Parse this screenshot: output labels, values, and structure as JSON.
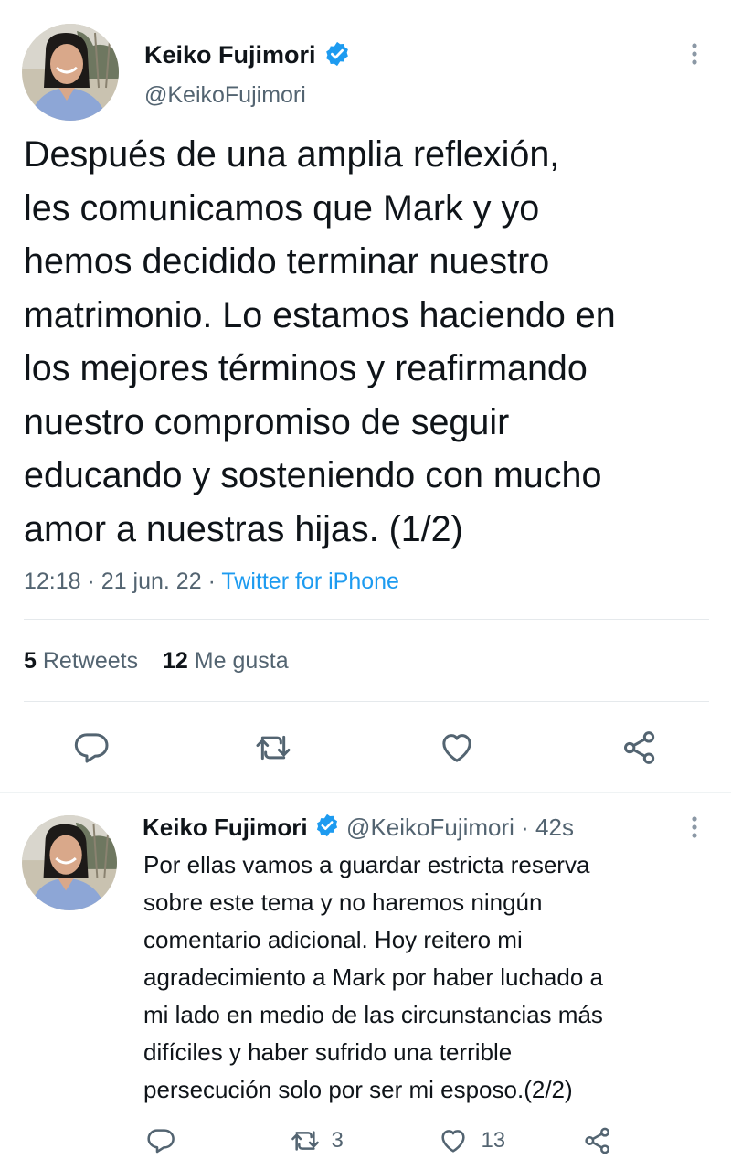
{
  "main_tweet": {
    "author_name": "Keiko Fujimori",
    "author_handle": "@KeikoFujimori",
    "text_lines": [
      "Después de una amplia reflexión,",
      "les comunicamos que Mark y yo",
      "hemos decidido terminar nuestro",
      "matrimonio. Lo estamos haciendo en",
      "los mejores términos y reafirmando",
      "nuestro compromiso de seguir",
      "educando y sosteniendo con mucho",
      "amor a nuestras hijas. (1/2)"
    ],
    "time": "12:18",
    "date": "21 jun. 22",
    "source": "Twitter for iPhone",
    "separator": "·",
    "retweets_count": "5",
    "retweets_label": "Retweets",
    "likes_count": "12",
    "likes_label": "Me gusta",
    "icons": [
      "reply-icon",
      "retweet-icon",
      "like-icon",
      "share-icon"
    ]
  },
  "reply_tweet": {
    "author_name": "Keiko Fujimori",
    "author_handle": "@KeikoFujimori",
    "age": "· 42s",
    "text_lines": [
      "Por ellas vamos a guardar estricta reserva",
      "sobre este tema y no haremos ningún",
      "comentario adicional. Hoy reitero mi",
      "agradecimiento a Mark por haber luchado a",
      "mi lado en medio de las circunstancias más",
      "difíciles y haber sufrido una terrible",
      "persecución solo por ser mi esposo.(2/2)"
    ],
    "retweets_count": "3",
    "likes_count": "13"
  },
  "colors": {
    "accent": "#1d9bf0",
    "text": "#0f1419",
    "secondary": "#536471",
    "divider": "#e5e9ec"
  }
}
